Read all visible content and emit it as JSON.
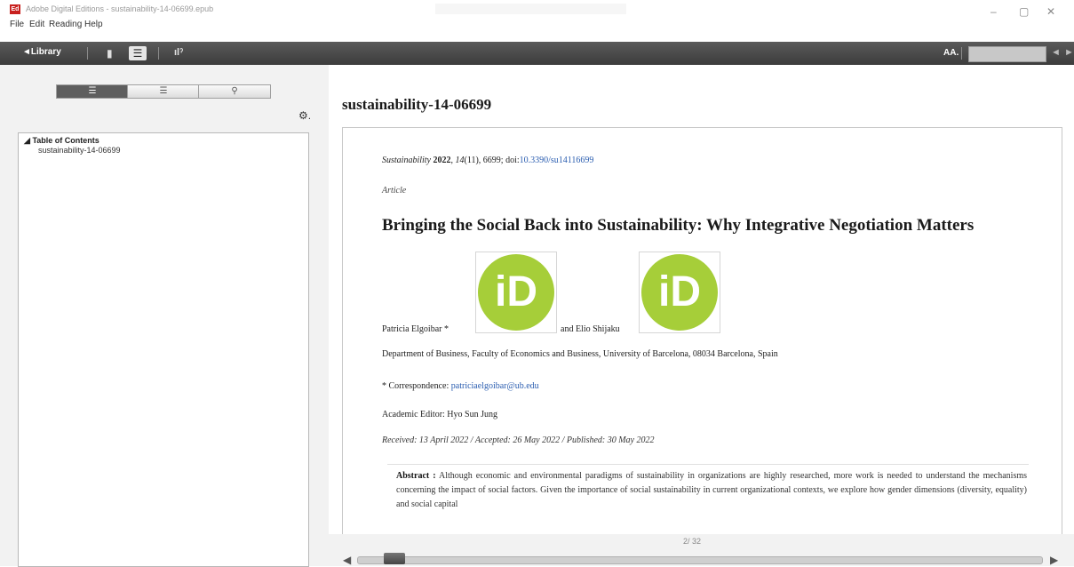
{
  "window": {
    "title": "Adobe Digital Editions - sustainability-14-06699.epub",
    "controls": {
      "minimize": "–",
      "maximize": "▢",
      "close": "✕"
    }
  },
  "menu": [
    "File",
    "Edit",
    "Reading",
    "Help"
  ],
  "toolbar": {
    "library_label": "◄Library",
    "font_size_label": "AA.",
    "search_value": ""
  },
  "sidebar": {
    "toc_header": "Table of Contents",
    "toc_items": [
      "sustainability-14-06699"
    ]
  },
  "content": {
    "doc_title": "sustainability-14-06699",
    "citation": {
      "journal": "Sustainability",
      "year": "2022",
      "volume": "14",
      "issue": "(11), 6699; doi:",
      "doi": "10.3390/su14116699"
    },
    "article_type": "Article",
    "article_title": "Bringing the Social Back into Sustainability: Why Integrative Negotiation Matters",
    "orcid_glyph": "iD",
    "author1": "Patricia Elgoibar *",
    "author2": "and Elio Shijaku",
    "affiliation": "Department of Business, Faculty of Economics and Business, University of Barcelona, 08034 Barcelona, Spain",
    "correspondence_label": "*   Correspondence:",
    "correspondence_email": "patriciaelgoibar@ub.edu",
    "academic_editor": "Academic Editor: Hyo Sun Jung",
    "dates": "Received: 13 April 2022 / Accepted: 26 May 2022 / Published: 30 May 2022",
    "abstract_label": "Abstract :",
    "abstract_text": "Although economic and environmental paradigms of sustainability in organizations are highly researched, more work is needed to understand the mechanisms concerning the impact of social factors. Given the importance of social sustainability in current organizational contexts, we explore how gender dimensions (diversity, equality) and social capital"
  },
  "footer": {
    "current_page": "2",
    "total_pages": "/ 32",
    "reading_progress": 0.05
  },
  "colors": {
    "toolbar": "#4a4a4a",
    "orcid_green": "#a6ce39",
    "link_blue": "#2a5db0"
  }
}
